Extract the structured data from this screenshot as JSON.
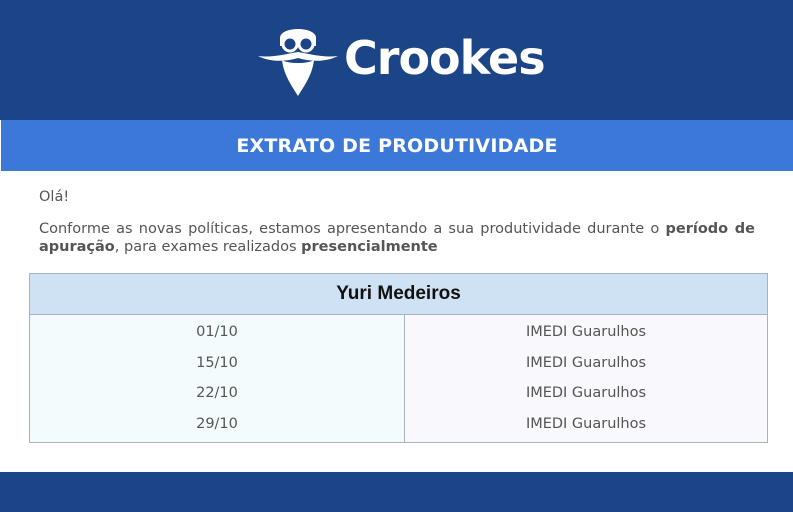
{
  "header": {
    "brand": "Crookes",
    "logo_icon": "bearded-scientist-icon"
  },
  "title": "EXTRATO DE PRODUTIVIDADE",
  "greeting": "Olá!",
  "intro": {
    "part1": "Conforme as novas políticas, estamos apresentando a sua produtividade durante o ",
    "bold1": "período de apuração",
    "part2": ", para exames realizados ",
    "bold2": "presencialmente"
  },
  "table": {
    "name": "Yuri Medeiros",
    "rows": [
      {
        "date": "01/10",
        "place": "IMEDI Guarulhos"
      },
      {
        "date": "15/10",
        "place": "IMEDI Guarulhos"
      },
      {
        "date": "22/10",
        "place": "IMEDI Guarulhos"
      },
      {
        "date": "29/10",
        "place": "IMEDI Guarulhos"
      }
    ]
  },
  "colors": {
    "header_bg": "#1c4587",
    "title_bg": "#3c78d8",
    "table_head_bg": "#cfe2f3"
  }
}
